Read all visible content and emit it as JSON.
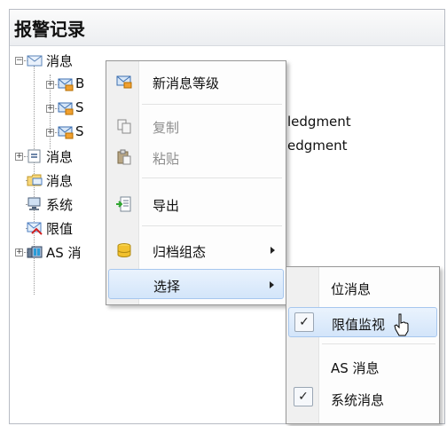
{
  "panel": {
    "title": "报警记录"
  },
  "tree": {
    "rows": [
      {
        "label": "消息",
        "icon": "envelope-icon"
      },
      {
        "label": "B",
        "icon": "envelope-group-icon"
      },
      {
        "label": "S",
        "suffix": "ledgment",
        "icon": "envelope-group-icon"
      },
      {
        "label": "S",
        "suffix": "edgment",
        "icon": "envelope-group-icon"
      },
      {
        "label": "消息",
        "icon": "list-icon"
      },
      {
        "label": "消息",
        "icon": "folder-envelope-icon"
      },
      {
        "label": "系统",
        "icon": "computer-icon"
      },
      {
        "label": "限值",
        "icon": "limit-envelope-icon"
      },
      {
        "label": "AS 消",
        "icon": "plc-icon"
      }
    ]
  },
  "context_menu": {
    "items": [
      {
        "label": "新消息等级",
        "icon": "new-class-icon",
        "enabled": true
      },
      {
        "label": "复制",
        "icon": "copy-icon",
        "enabled": false
      },
      {
        "label": "粘贴",
        "icon": "paste-icon",
        "enabled": false
      },
      {
        "label": "导出",
        "icon": "export-icon",
        "enabled": true
      },
      {
        "label": "归档组态",
        "icon": "archive-icon",
        "enabled": true
      },
      {
        "label": "选择",
        "icon": "",
        "enabled": true
      }
    ]
  },
  "submenu": {
    "items": [
      {
        "label": "位消息",
        "checked": false
      },
      {
        "label": "限值监视",
        "checked": true
      },
      {
        "label": "AS 消息",
        "checked": false
      },
      {
        "label": "系统消息",
        "checked": true
      }
    ],
    "check_glyph": "✓"
  }
}
